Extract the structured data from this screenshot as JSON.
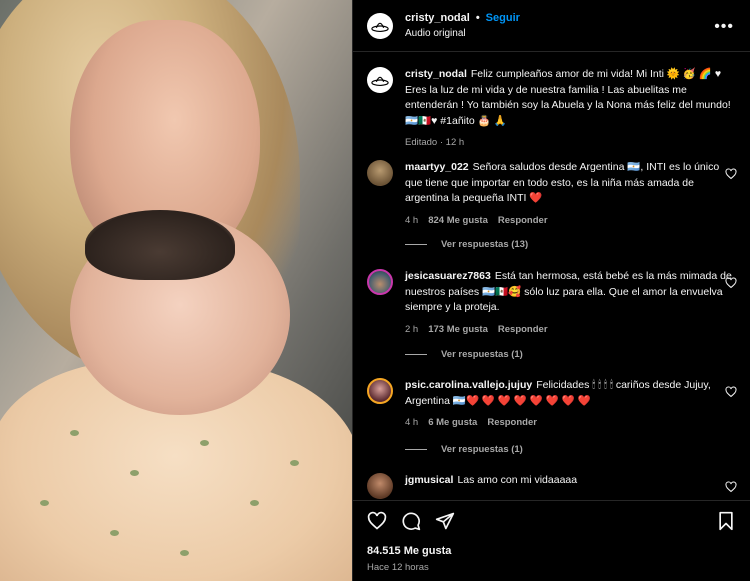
{
  "post": {
    "username": "cristy_nodal",
    "follow_label": "Seguir",
    "audio": "Audio original",
    "separator": "•"
  },
  "caption": {
    "username": "cristy_nodal",
    "text": "Feliz cumpleaños amor de mi vida! Mi Inti 🌞 🥳 🌈 ♥ Eres la luz de mi vida y de nuestra familia ! Las abuelitas me entenderán ! Yo también soy la Abuela y la Nona más feliz del mundo! 🇦🇷🇲🇽♥ #1añito 🎂 🙏",
    "time": "Editado · 12 h"
  },
  "comments": [
    {
      "username": "maartyy_022",
      "text": "Señora saludos desde Argentina 🇦🇷, INTI es lo único que tiene que importar en todo esto, es la niña más amada de argentina la pequeña INTI ❤️",
      "time": "4 h",
      "likes": "824 Me gusta",
      "reply": "Responder",
      "replies": "Ver respuestas (13)"
    },
    {
      "username": "jesicasuarez7863",
      "text": "Está tan hermosa, está bebé es la más mimada de nuestros países 🇦🇷🇲🇽🥰 sólo luz para ella. Que el amor la envuelva siempre y la proteja.",
      "time": "2 h",
      "likes": "173 Me gusta",
      "reply": "Responder",
      "replies": "Ver respuestas (1)"
    },
    {
      "username": "psic.carolina.vallejo.jujuy",
      "text": "Felicidades 🕯 🕯 🕯 🕯 cariños desde Jujuy, Argentina 🇦🇷❤️ ❤️ ❤️ ❤️ ❤️ ❤️ ❤️ ❤️",
      "time": "4 h",
      "likes": "6 Me gusta",
      "reply": "Responder",
      "replies": "Ver respuestas (1)"
    },
    {
      "username": "jgmusical",
      "text": "Las amo con mi vidaaaaa"
    }
  ],
  "footer": {
    "likes": "84.515 Me gusta",
    "time": "Hace 12 horas"
  },
  "colors": {
    "accent": "#0095f6",
    "background": "#000000",
    "muted": "#a8a8a8",
    "like": "#ed4956"
  },
  "icons": [
    "more-icon",
    "heart-icon",
    "comment-icon",
    "share-icon",
    "bookmark-icon"
  ]
}
